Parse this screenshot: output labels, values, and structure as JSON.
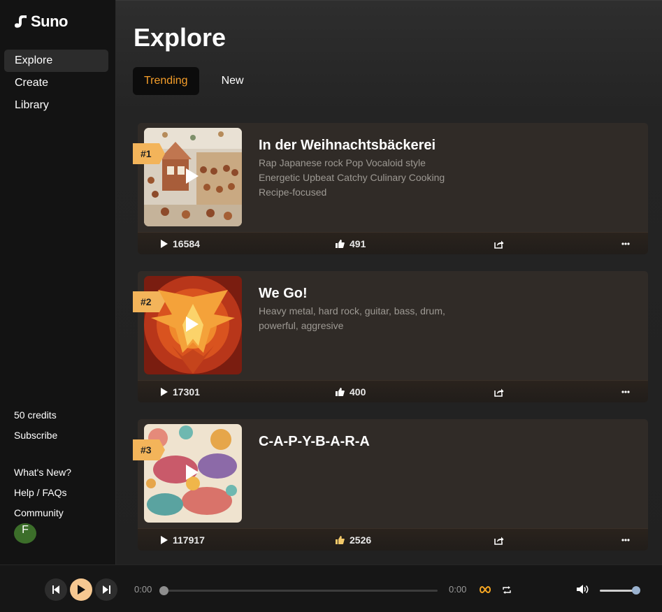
{
  "brand": {
    "name": "Suno"
  },
  "sidebar": {
    "nav": [
      {
        "label": "Explore",
        "active": true
      },
      {
        "label": "Create",
        "active": false
      },
      {
        "label": "Library",
        "active": false
      }
    ],
    "credits": "50 credits",
    "subscribe": "Subscribe",
    "links": [
      "What's New?",
      "Help / FAQs",
      "Community"
    ],
    "avatar_initial": "F"
  },
  "main": {
    "title": "Explore",
    "tabs": [
      {
        "label": "Trending",
        "active": true
      },
      {
        "label": "New",
        "active": false
      }
    ]
  },
  "songs": [
    {
      "rank": "#1",
      "title": "In der Weihnachtsbäckerei",
      "tags": "Rap Japanese rock Pop Vocaloid style Energetic Upbeat Catchy Culinary Cooking Recipe-focused",
      "plays": "16584",
      "likes": "491"
    },
    {
      "rank": "#2",
      "title": "We Go!",
      "tags": "Heavy metal, hard rock, guitar, bass, drum, powerful, aggresive",
      "plays": "17301",
      "likes": "400"
    },
    {
      "rank": "#3",
      "title": "C-A-P-Y-B-A-R-A",
      "tags": "",
      "plays": "117917",
      "likes": "2526"
    }
  ],
  "player": {
    "current_time": "0:00",
    "total_time": "0:00",
    "progress": 0,
    "volume": 1.0
  },
  "colors": {
    "accent": "#f59e2a",
    "rank_badge": "#f3b45a",
    "play_button": "#f6c891"
  }
}
